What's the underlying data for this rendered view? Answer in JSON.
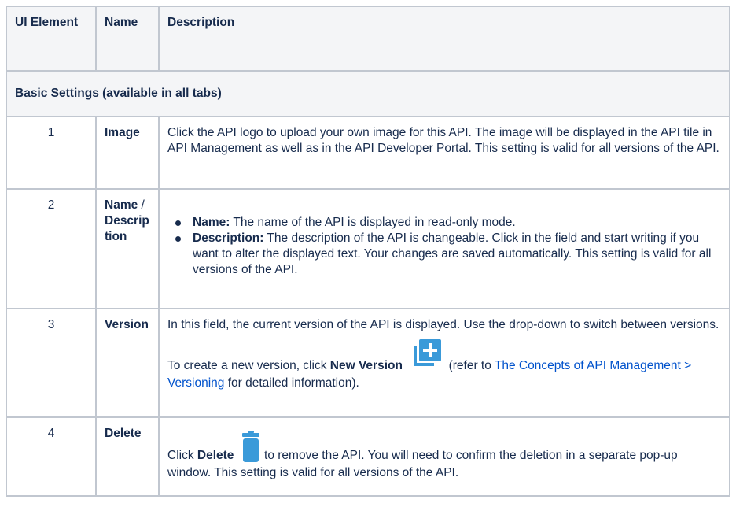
{
  "table": {
    "headers": {
      "ui_element": "UI Element",
      "name": "Name",
      "description": "Description"
    },
    "section": "Basic Settings (available in all tabs)",
    "rows": [
      {
        "num": "1",
        "name": "Image",
        "desc": "Click the API logo to upload your own image for this API. The image will be displayed in the API tile in API Management as well as in the API Developer Portal. This setting is valid for all versions of the API."
      },
      {
        "num": "2",
        "name_bold": "Name",
        "name_rest": " / Description",
        "bullets": [
          {
            "label": "Name:",
            "text": " The name of the API is displayed in read-only mode."
          },
          {
            "label": "Description:",
            "text": " The description of the API is changeable. Click in the field and start writing if you want to alter the displayed text. Your changes are saved automatically. This setting is valid for all versions of the API."
          }
        ]
      },
      {
        "num": "3",
        "name": "Version",
        "desc1": "In this field, the current version of the API is displayed. Use the drop-down to switch between versions.",
        "desc2_pre": "To create a new version, click ",
        "desc2_bold": "New Version",
        "desc2_mid": " (refer to ",
        "desc2_link": "The Concepts of API Management > Versioning",
        "desc2_post": " for detailed information)."
      },
      {
        "num": "4",
        "name": "Delete",
        "desc_pre": "Click ",
        "desc_bold": "Delete",
        "desc_post": " to remove the API. You will need to confirm the deletion in a separate pop-up window. This setting is valid for all versions of the API."
      }
    ]
  },
  "colors": {
    "icon_blue": "#3a9ad9",
    "link": "#0052cc",
    "border": "#c1c7d0",
    "header_bg": "#f4f5f7"
  },
  "icons": {
    "new_version": "new-version-icon",
    "delete": "trash-icon"
  }
}
